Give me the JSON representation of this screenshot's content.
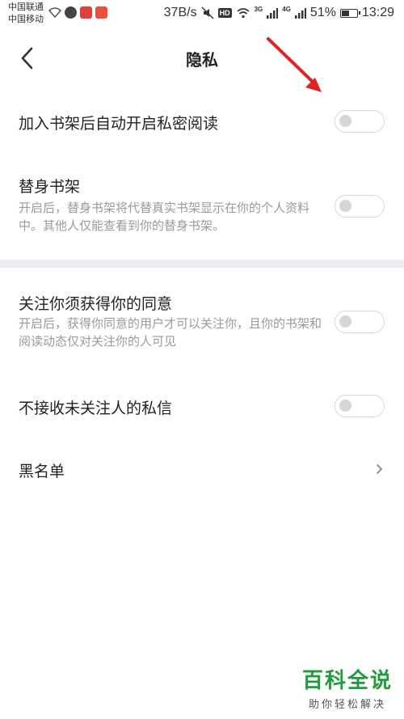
{
  "status_bar": {
    "carrier_1": "中国联通",
    "carrier_2": "中国移动",
    "net_speed": "37B/s",
    "hd_label": "HD",
    "net_3g": "3G",
    "net_4g": "4G",
    "battery": "51%",
    "battery_level": 0.51,
    "time": "13:29",
    "icons": [
      "wifi-icon",
      "chat-icon",
      "netease-music-icon",
      "app-icon",
      "mute-icon",
      "signal-icon"
    ]
  },
  "header": {
    "title": "隐私",
    "back_icon": "chevron-left-icon"
  },
  "settings": [
    {
      "title": "加入书架后自动开启私密阅读",
      "enabled": false
    },
    {
      "title": "替身书架",
      "description": "开启后，替身书架将代替真实书架显示在你的个人资料中。其他人仅能查看到你的替身书架。",
      "enabled": false
    },
    {
      "title": "关注你须获得你的同意",
      "description": "开启后，获得你同意的用户才可以关注你，且你的书架和阅读动态仅对关注你的人可见",
      "enabled": false
    },
    {
      "title": "不接收未关注人的私信",
      "enabled": false
    }
  ],
  "blacklist": {
    "title": "黑名单"
  },
  "watermark": {
    "title": "百科全说",
    "subtitle": "助你轻松解决"
  },
  "colors": {
    "annotation_arrow": "#e02424",
    "watermark_green": "#1f9c3c",
    "toggle_off": "#d6d6d6"
  }
}
